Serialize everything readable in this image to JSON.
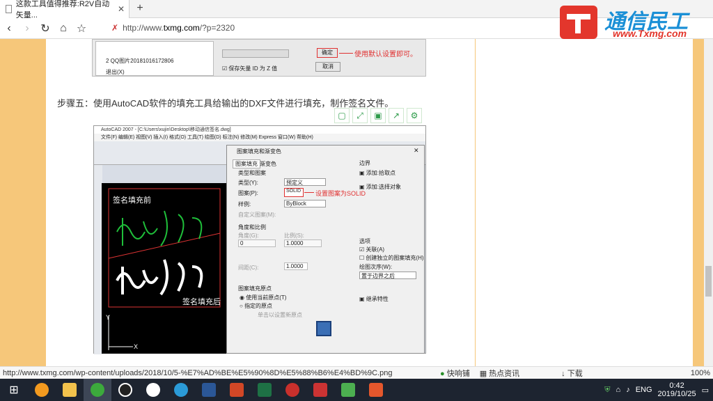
{
  "browser": {
    "tab_title": "这款工具值得推荐:R2V自动矢量...",
    "url_prefix": "http://www.",
    "url_domain": "txmg.com",
    "url_suffix": "/?p=2320"
  },
  "logo": {
    "name": "通信民工",
    "site": "www.Txmg.com"
  },
  "article": {
    "top_screenshot": {
      "menu1": "2 QQ图片20181016172806",
      "menu2": "退出(X)",
      "ok": "确定",
      "ok_note": "使用默认设置即可。",
      "checkbox": "保存矢量 ID 为 Z 值",
      "cancel": "取消"
    },
    "step_text": "步骤五：使用AutoCAD软件的填充工具给输出的DXF文件进行填充，制作签名文件。",
    "cad": {
      "title": "AutoCAD 2007 - [C:\\Users\\xujin\\Desktop\\移动通信签名.dwg]",
      "menu": "文件(F)  编辑(E)  视图(V)  插入(I)  格式(O)  工具(T)  绘图(D)  标注(N)  修改(M)  Express  窗口(W)  帮助(H)",
      "canvas_before": "签名填充前",
      "canvas_after": "签名填充后",
      "dialog_title": "图案填充和渐变色",
      "tab1": "图案填充",
      "tab2": "渐变色",
      "type_group": "类型和图案",
      "type_label": "类型(Y):",
      "type_value": "预定义",
      "pattern_label": "图案(P):",
      "pattern_value": "SOLID",
      "pattern_note": "设置图案为SOLID",
      "sample_label": "样例:",
      "sample_value": "ByBlock",
      "custom_label": "自定义图案(M):",
      "angle_group": "角度和比例",
      "angle_label": "角度(G):",
      "angle_value": "0",
      "scale_label": "比例(S):",
      "scale_value": "1.0000",
      "spacing_label": "间距(C):",
      "spacing_value": "1.0000",
      "origin_group": "图案填充原点",
      "origin_opt1": "使用当前原点(T)",
      "origin_opt2": "指定的原点",
      "origin_sub": "单击以设置新原点",
      "boundary": "边界",
      "add_pick": "添加:拾取点",
      "add_select": "添加:选择对象",
      "options": "选项",
      "assoc": "关联(A)",
      "create_sep": "创建独立的图案填充(H)",
      "draw_order": "绘图次序(W):",
      "draw_order_value": "置于边界之后",
      "inherit": "继承特性"
    }
  },
  "statusbar": {
    "link": "http://www.txmg.com/wp-content/uploads/2018/10/5-%E7%AD%BE%E5%90%8D%E5%88%B6%E4%BD%9C.png",
    "quick": "快响铺",
    "hot": "热点资讯",
    "download": "下载",
    "zoom": "100%"
  },
  "taskbar": {
    "lang": "ENG",
    "time": "0:42",
    "date": "2019/10/25"
  }
}
